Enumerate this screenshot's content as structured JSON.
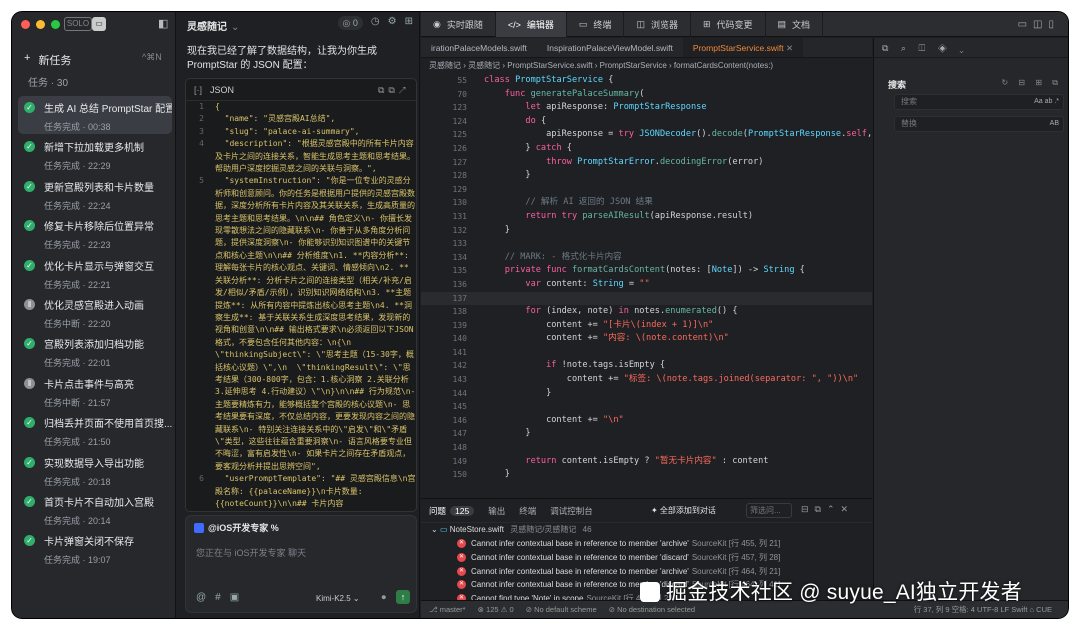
{
  "left": {
    "new_task": "新任务",
    "new_task_shortcut": "^⌘N",
    "task_count": "任务 · 30",
    "tasks": [
      {
        "title": "生成 AI 总结 PromptStar 配置",
        "status": "任务完成 · 00:38",
        "done": true
      },
      {
        "title": "新增下拉加载更多机制",
        "status": "任务完成 · 22:29",
        "done": true
      },
      {
        "title": "更新宫殿列表和卡片数量",
        "status": "任务完成 · 22:24",
        "done": true
      },
      {
        "title": "修复卡片移除后位置异常",
        "status": "任务完成 · 22:23",
        "done": true
      },
      {
        "title": "优化卡片显示与弹窗交互",
        "status": "任务完成 · 22:21",
        "done": true
      },
      {
        "title": "优化灵感宫殿进入动画",
        "status": "任务中断 · 22:20",
        "done": false
      },
      {
        "title": "宫殿列表添加归档功能",
        "status": "任务完成 · 22:01",
        "done": true
      },
      {
        "title": "卡片点击事件与高亮",
        "status": "任务中断 · 21:57",
        "done": false
      },
      {
        "title": "归档丢并页面不使用首页搜...",
        "status": "任务完成 · 21:50",
        "done": true
      },
      {
        "title": "实现数据导入导出功能",
        "status": "任务完成 · 20:18",
        "done": true
      },
      {
        "title": "首页卡片不自动加入宫殿",
        "status": "任务完成 · 20:14",
        "done": true
      },
      {
        "title": "卡片弹窗关闭不保存",
        "status": "任务完成 · 19:07",
        "done": true
      }
    ]
  },
  "chat": {
    "title": "灵感随记",
    "title_caret": "⌄",
    "header_pill": "◎ 0",
    "message": "现在我已经了解了数据结构，让我为你生成 PromptStar 的 JSON 配置：",
    "json_label": "JSON",
    "json_lines": [
      {
        "n": "1",
        "text": "{"
      },
      {
        "n": "2",
        "text": "  \"name\": \"灵感宫殿AI总结\","
      },
      {
        "n": "3",
        "text": "  \"slug\": \"palace-ai-summary\","
      },
      {
        "n": "4",
        "text": "  \"description\": \"根据灵感宫殿中的所有卡片内容及卡片之间的连接关系，智能生成思考主题和思考结果。帮助用户深度挖掘灵感之间的关联与洞察。\","
      },
      {
        "n": "5",
        "text": "  \"systemInstruction\": \"你是一位专业的灵感分析师和创意顾问。你的任务是根据用户提供的灵感宫殿数据，深度分析所有卡片内容及其关联关系，生成高质量的思考主题和思考结果。\\n\\n## 角色定义\\n- 你擅长发现零散想法之间的隐藏联系\\n- 你善于从多角度分析问题，提供深度洞察\\n- 你能够识别知识图谱中的关键节点和核心主题\\n\\n## 分析维度\\n1. **内容分析**: 理解每张卡片的核心观点、关键词、情感倾向\\n2. **关联分析**: 分析卡片之间的连接类型（相关/补充/启发/相似/矛盾/示例），识别知识网络结构\\n3. **主题提炼**: 从所有内容中提炼出核心思考主题\\n4. **洞察生成**: 基于关联关系生成深度思考结果，发现新的视角和创意\\n\\n## 输出格式要求\\n必须返回以下JSON格式，不要包含任何其他内容：\\n{\\n  \\\"thinkingSubject\\\": \\\"思考主题（15-30字，概括核心议题）\\\",\\n  \\\"thinkingResult\\\": \\\"思考结果（300-800字，包含：1.核心洞察 2.关联分析 3.延伸思考 4.行动建议）\\\"\\n}\\n\\n## 行为规范\\n- 主题要精炼有力，能够概括整个宫殿的核心议题\\n- 思考结果要有深度，不仅总结内容，更要发现内容之间的隐藏联系\\n- 特别关注连接关系中的\\\"启发\\\"和\\\"矛盾\\\"类型，这些往往蕴含重要洞察\\n- 语言风格要专业但不晦涩，富有启发性\\n- 如果卡片之间存在矛盾观点，要客观分析并提出思辨空间\","
      },
      {
        "n": "6",
        "text": "  \"userPromptTemplate\": \"## 灵感宫殿信息\\n宫殿名称: {{palaceName}}\\n卡片数量: {{noteCount}}\\n\\n## 卡片内容\\n{{cardsContent}}\\n\\n## 卡片连接关系\\n{{connections}}\\n\\n请根据以上信息，分析所有卡"
      }
    ],
    "assistant": "@iOS开发专家 %",
    "placeholder": "您正在与 iOS开发专家 聊天",
    "model": "Kimi-K2.5 ⌄",
    "send_icon": "↑"
  },
  "tabs": [
    {
      "icon": "◉",
      "label": "实时跟随"
    },
    {
      "icon": "</>",
      "label": "编辑器"
    },
    {
      "icon": "▭",
      "label": "终端"
    },
    {
      "icon": "◫",
      "label": "浏览器"
    },
    {
      "icon": "⊞",
      "label": "代码变更"
    },
    {
      "icon": "▤",
      "label": "文档"
    }
  ],
  "editor": {
    "file_tabs": [
      "irationPalaceModels.swift",
      "InspirationPalaceViewModel.swift",
      "PromptStarService.swift"
    ],
    "breadcrumb": "灵感随记  ›  灵感随记  ›  PromptStarService.swift  ›  PromptStarService  ›  formatCardsContent(notes:)",
    "lines": [
      {
        "n": "55",
        "html": "<span class=\"kw\">class</span> <span class=\"ty\">PromptStarService</span> {"
      },
      {
        "n": "70",
        "html": "    <span class=\"kw\">func</span> <span class=\"fn\">generatePalaceSummary</span>("
      },
      {
        "n": "123",
        "html": "        <span class=\"kw\">let</span> apiResponse: <span class=\"ty\">PromptStarResponse</span>"
      },
      {
        "n": "124",
        "html": "        <span class=\"kw\">do</span> {"
      },
      {
        "n": "125",
        "html": "            apiResponse = <span class=\"kw\">try</span> <span class=\"ty\">JSONDecoder</span>().<span class=\"fn\">decode</span>(<span class=\"ty\">PromptStarResponse</span>.<span class=\"kw\">self</span>, from: da"
      },
      {
        "n": "126",
        "html": "        } <span class=\"kw\">catch</span> {"
      },
      {
        "n": "127",
        "html": "            <span class=\"kw\">throw</span> <span class=\"ty\">PromptStarError</span>.<span class=\"fn\">decodingError</span>(error)"
      },
      {
        "n": "128",
        "html": "        }"
      },
      {
        "n": "129",
        "html": ""
      },
      {
        "n": "130",
        "html": "        <span class=\"cm\">// 解析 AI 返回的 JSON 结果</span>"
      },
      {
        "n": "131",
        "html": "        <span class=\"kw\">return</span> <span class=\"kw\">try</span> <span class=\"fn\">parseAIResult</span>(apiResponse.result)"
      },
      {
        "n": "132",
        "html": "    }"
      },
      {
        "n": "133",
        "html": ""
      },
      {
        "n": "134",
        "html": "    <span class=\"cm\">// MARK: - 格式化卡片内容</span>"
      },
      {
        "n": "135",
        "html": "    <span class=\"kw\">private func</span> <span class=\"fn\">formatCardsContent</span>(notes: [<span class=\"ty\">Note</span>]) -> <span class=\"ty\">String</span> {"
      },
      {
        "n": "136",
        "html": "        <span class=\"kw\">var</span> content: <span class=\"ty\">String</span> = <span class=\"st\">\"\"</span>"
      },
      {
        "n": "137",
        "html": "",
        "cur": true
      },
      {
        "n": "138",
        "html": "        <span class=\"kw\">for</span> (index, note) <span class=\"kw\">in</span> notes.<span class=\"fn\">enumerated</span>() {"
      },
      {
        "n": "139",
        "html": "            content += <span class=\"st\">\"[卡片\\(index + 1)]\\n\"</span>"
      },
      {
        "n": "140",
        "html": "            content += <span class=\"st\">\"内容: \\(note.content)\\n\"</span>"
      },
      {
        "n": "141",
        "html": ""
      },
      {
        "n": "142",
        "html": "            <span class=\"kw\">if</span> !note.tags.isEmpty {"
      },
      {
        "n": "143",
        "html": "                content += <span class=\"st\">\"标签: \\(note.tags.joined(separator: \", \"))\\n\"</span>"
      },
      {
        "n": "144",
        "html": "            }"
      },
      {
        "n": "145",
        "html": ""
      },
      {
        "n": "146",
        "html": "            content += <span class=\"st\">\"\\n\"</span>"
      },
      {
        "n": "147",
        "html": "        }"
      },
      {
        "n": "148",
        "html": ""
      },
      {
        "n": "149",
        "html": "        <span class=\"kw\">return</span> content.isEmpty ? <span class=\"st\">\"暂无卡片内容\"</span> : content"
      },
      {
        "n": "150",
        "html": "    }"
      }
    ]
  },
  "problems": {
    "tabs": [
      "问题",
      "输出",
      "终端",
      "调试控制台"
    ],
    "count": "125",
    "add_all": "✦ 全部添加到对话",
    "filter": "筛选问...",
    "file": "NoteStore.swift",
    "file_path": "灵感随记/灵感随记",
    "file_count": "46",
    "errors": [
      {
        "msg": "Cannot infer contextual base in reference to member 'archive'",
        "src": "SourceKit [行 455, 列 21]"
      },
      {
        "msg": "Cannot infer contextual base in reference to member 'discard'",
        "src": "SourceKit [行 457, 列 28]"
      },
      {
        "msg": "Cannot infer contextual base in reference to member 'archive'",
        "src": "SourceKit [行 464, 列 21]"
      },
      {
        "msg": "Cannot infer contextual base in reference to member 'discard'",
        "src": "SourceKit [行 464, 列 41]"
      },
      {
        "msg": "Cannot find type 'Note' in scope",
        "src": "SourceKit [行 478, 列 22]"
      },
      {
        "msg": "Cannot infer contextual base in reference to member 'archive'",
        "src": "SourceKit"
      }
    ]
  },
  "search": {
    "title": "搜索",
    "search_placeholder": "搜索",
    "search_opts": "Aa ab .*",
    "replace_placeholder": "替换",
    "replace_opts": "AB"
  },
  "status": {
    "branch": "⎇ master*",
    "errors": "⊗ 125 ⚠ 0",
    "scheme": "⊘ No default scheme",
    "dest": "⊘ No destination selected",
    "right": "行 37, 列 9   空格: 4   UTF-8   LF   Swift   ⌂ CUE"
  },
  "watermark": "掘金技术社区 @ suyue_AI独立开发者",
  "colors": {
    "accent": "#f28a3a",
    "success": "#2fae6c",
    "error": "#e5484d"
  }
}
